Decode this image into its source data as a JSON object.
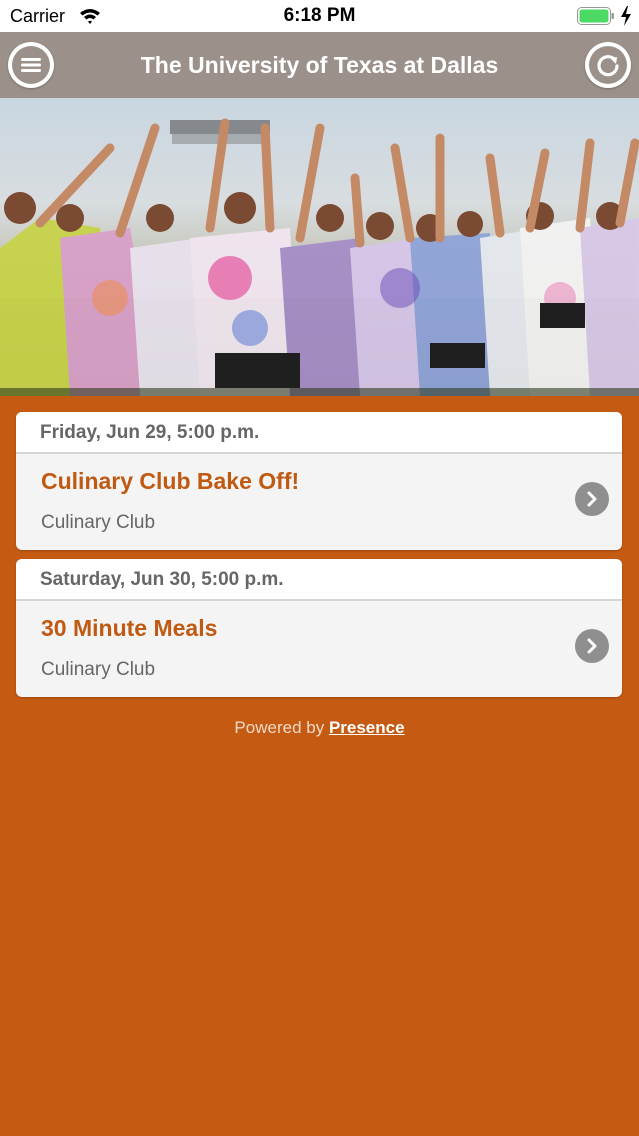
{
  "status_bar": {
    "carrier": "Carrier",
    "time": "6:18 PM",
    "battery_color": "#4cd964"
  },
  "nav": {
    "title": "The University of Texas at Dallas",
    "left_icon": "menu-icon",
    "right_icon": "refresh-icon",
    "bar_color": "#9b918a"
  },
  "hero": {
    "description_icon": "hero-photo"
  },
  "events": [
    {
      "date": "Friday, Jun 29, 5:00 p.m.",
      "title": "Culinary Club Bake Off!",
      "organization": "Culinary Club"
    },
    {
      "date": "Saturday, Jun 30, 5:00 p.m.",
      "title": "30 Minute Meals",
      "organization": "Culinary Club"
    }
  ],
  "footer": {
    "prefix": "Powered by",
    "link": "Presence"
  },
  "colors": {
    "background": "#c55b12",
    "accent_text": "#c05a12"
  }
}
